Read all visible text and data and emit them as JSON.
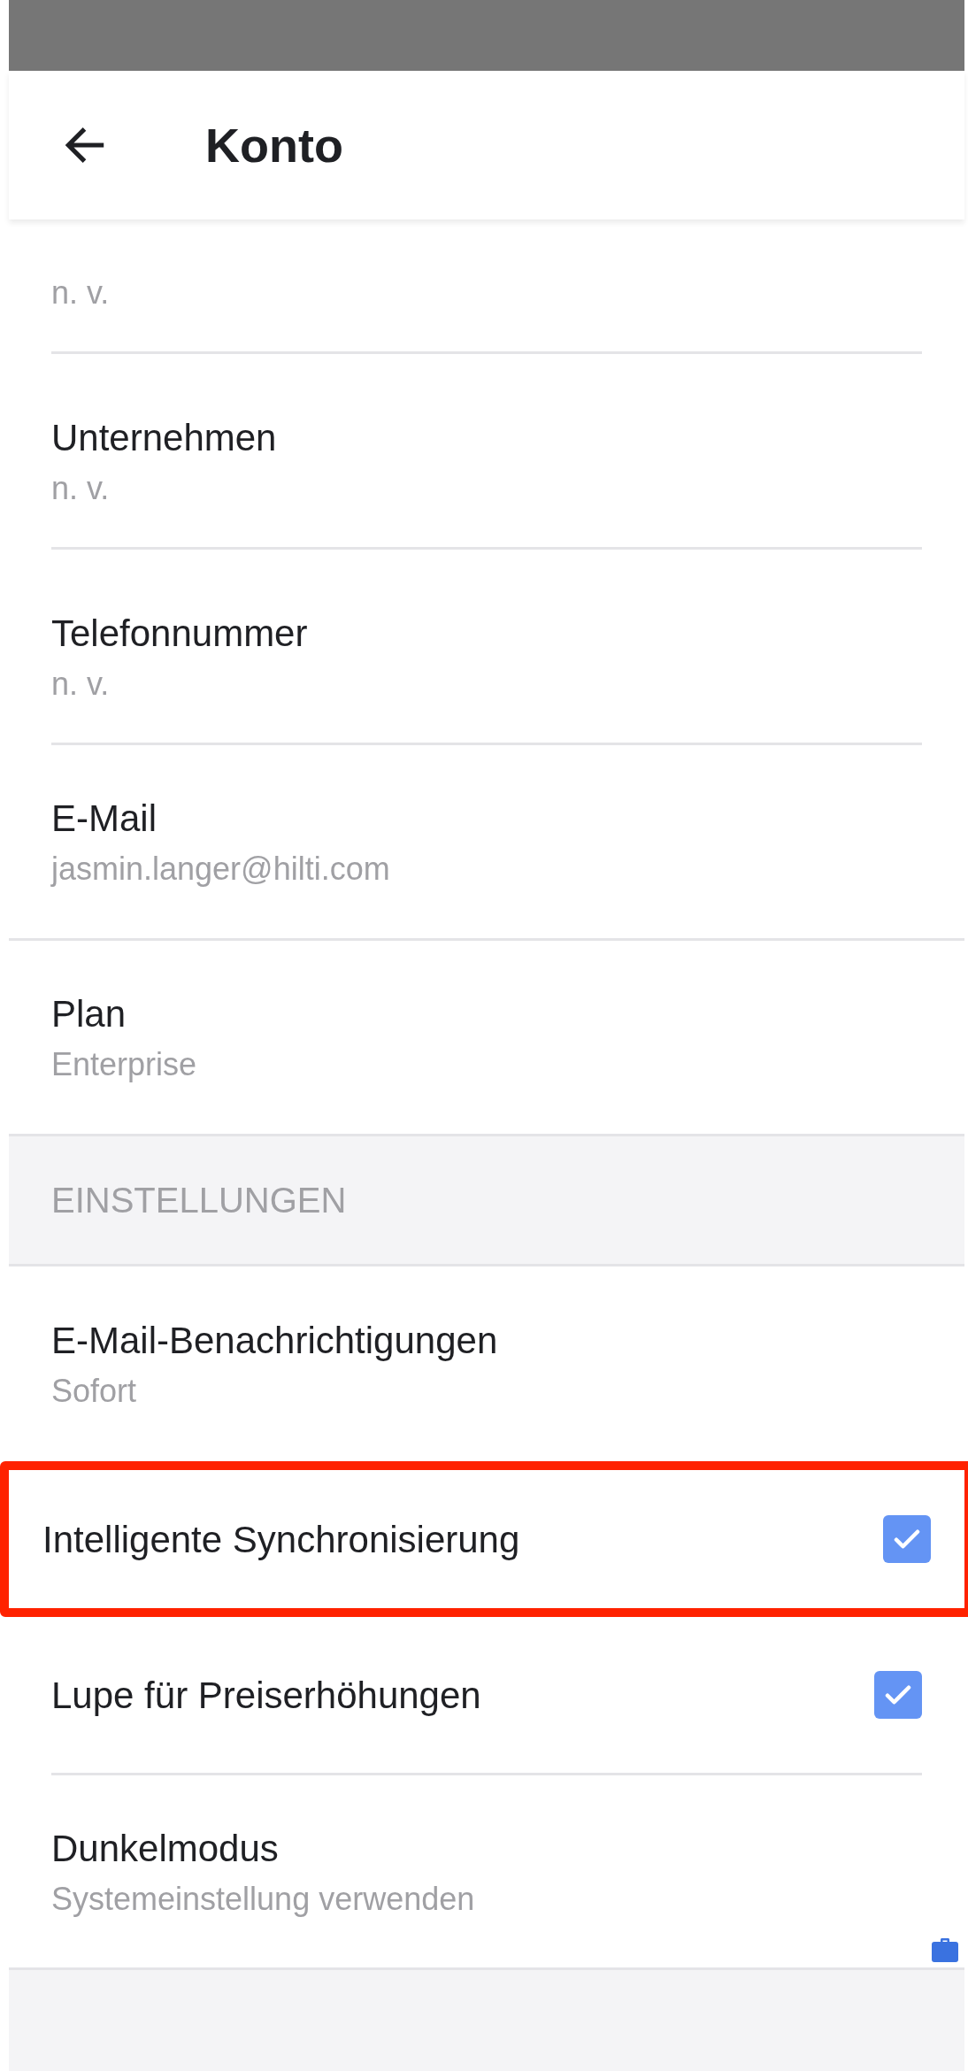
{
  "header": {
    "title": "Konto"
  },
  "account_items": [
    {
      "value": "n. v.",
      "full_divider": false
    },
    {
      "label": "Unternehmen",
      "value": "n. v.",
      "full_divider": false
    },
    {
      "label": "Telefonnummer",
      "value": "n. v.",
      "full_divider": false
    },
    {
      "label": "E-Mail",
      "value": "jasmin.langer@hilti.com",
      "full_divider": true
    },
    {
      "label": "Plan",
      "value": "Enterprise",
      "full_divider": true
    }
  ],
  "settings_section": {
    "title": "EINSTELLUNGEN",
    "items": [
      {
        "kind": "value",
        "label": "E-Mail-Benachrichtigungen",
        "value": "Sofort",
        "highlighted": false
      },
      {
        "kind": "checkbox",
        "label": "Intelligente Synchronisierung",
        "checked": true,
        "highlighted": true
      },
      {
        "kind": "checkbox",
        "label": "Lupe für Preiserhöhungen",
        "checked": true,
        "highlighted": false
      },
      {
        "kind": "value",
        "label": "Dunkelmodus",
        "value": "Systemeinstellung verwenden",
        "highlighted": false
      }
    ]
  }
}
